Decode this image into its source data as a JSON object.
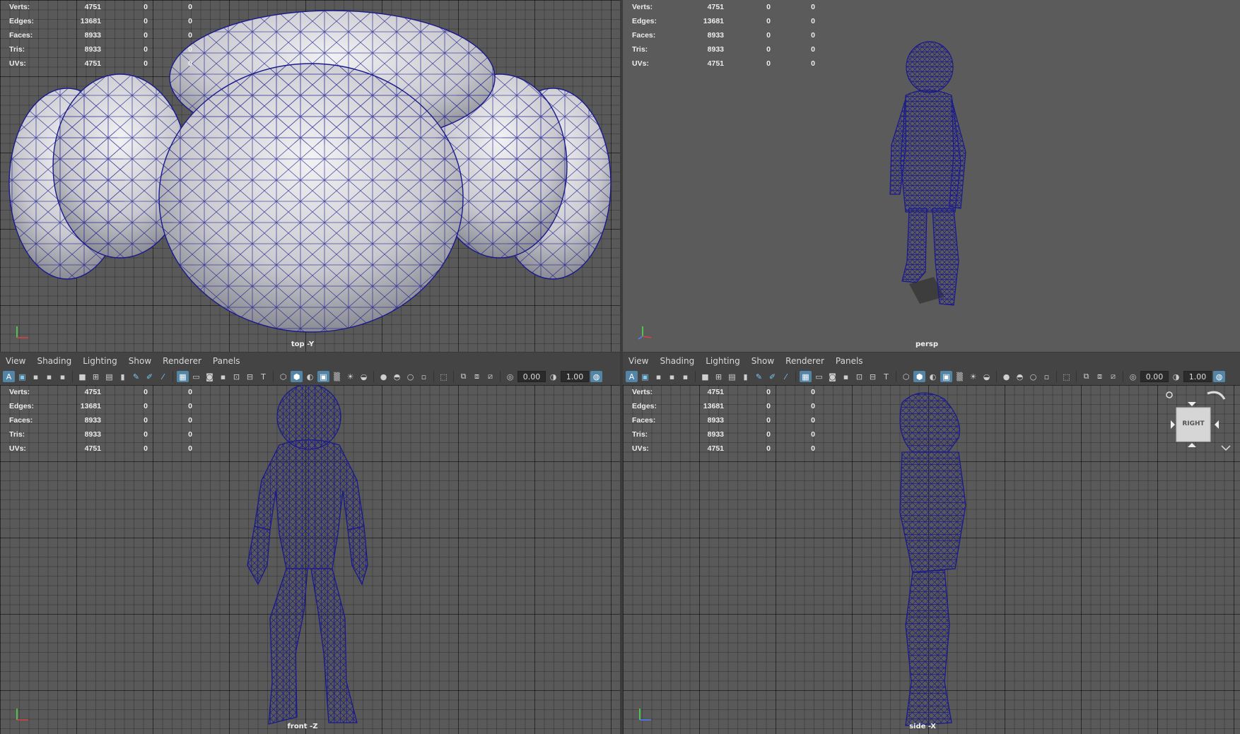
{
  "panel_menu": [
    "View",
    "Shading",
    "Lighting",
    "Show",
    "Renderer",
    "Panels"
  ],
  "toolbar": {
    "value_a": "0.00",
    "value_b": "1.00"
  },
  "hud": {
    "rows": [
      {
        "label": "Verts:",
        "value": "4751",
        "z1": "0",
        "z2": "0"
      },
      {
        "label": "Edges:",
        "value": "13681",
        "z1": "0",
        "z2": "0"
      },
      {
        "label": "Faces:",
        "value": "8933",
        "z1": "0",
        "z2": "0"
      },
      {
        "label": "Tris:",
        "value": "8933",
        "z1": "0",
        "z2": "0"
      },
      {
        "label": "UVs:",
        "value": "4751",
        "z1": "0",
        "z2": "0"
      }
    ]
  },
  "viewports": {
    "top": {
      "camera": "top -Y"
    },
    "persp": {
      "camera": "persp"
    },
    "front": {
      "camera": "front -Z"
    },
    "side": {
      "camera": "side -X"
    }
  },
  "viewcube": {
    "face_label": "RIGHT"
  },
  "colors": {
    "wire": "#1a1a8c",
    "grid_bg": "#595959",
    "active_tool": "#5285a6"
  }
}
